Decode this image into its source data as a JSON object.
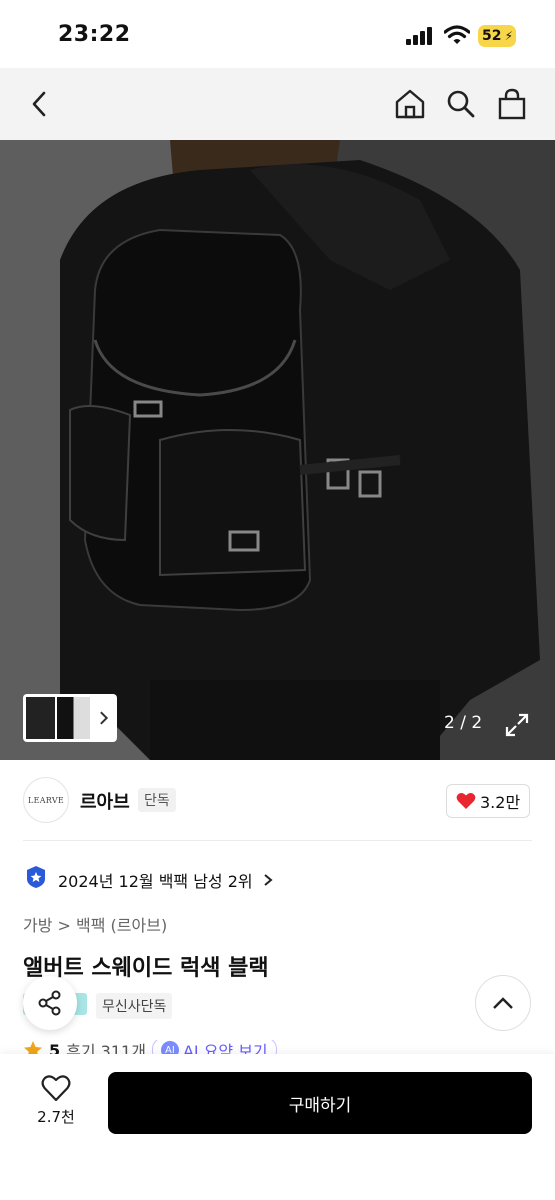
{
  "status": {
    "time": "23:22",
    "battery": "52"
  },
  "nav": {
    "back": "back-icon",
    "home": "home-icon",
    "search": "search-icon",
    "bag": "bag-icon"
  },
  "gallery": {
    "counter": "2 / 2"
  },
  "brand": {
    "logo_text": "LEARVE",
    "name": "르아브",
    "exclusive_badge": "단독",
    "likes": "3.2만"
  },
  "ranking": {
    "text": "2024년 12월 백팩 남성 2위"
  },
  "breadcrumb": {
    "text": "가방 > 백팩 (르아브)"
  },
  "product": {
    "title": "앨버트 스웨이드 럭색 블랙",
    "tag": "무신사단독"
  },
  "rating": {
    "score": "5",
    "reviews": "후기 311개",
    "ai_label": "AI",
    "ai_summary": "AI 요약 보기"
  },
  "bottom": {
    "wish_count": "2.7천",
    "buy_label": "구매하기"
  },
  "colors": {
    "heart": "#e8262f",
    "ai_accent": "#6a5cff",
    "badge": "#2b5ad9"
  }
}
